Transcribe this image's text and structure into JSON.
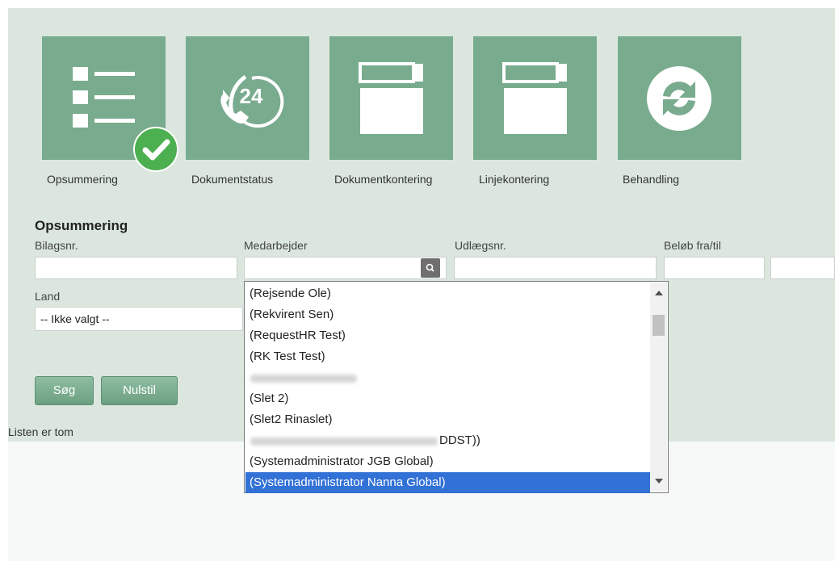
{
  "wizard": {
    "steps": [
      {
        "label": "Opsummering",
        "icon": "list-icon",
        "completed": true
      },
      {
        "label": "Dokumentstatus",
        "icon": "phone-24-icon"
      },
      {
        "label": "Dokumentkontering",
        "icon": "window-icon"
      },
      {
        "label": "Linjekontering",
        "icon": "window-icon"
      },
      {
        "label": "Behandling",
        "icon": "refresh-icon"
      }
    ]
  },
  "form": {
    "title": "Opsummering",
    "fields": {
      "bilagsnr": {
        "label": "Bilagsnr.",
        "value": ""
      },
      "medarbejder": {
        "label": "Medarbejder",
        "value": ""
      },
      "udlaegsnr": {
        "label": "Udlægsnr.",
        "value": ""
      },
      "beloeb": {
        "label": "Beløb fra/til",
        "from": "",
        "to": ""
      },
      "land": {
        "label": "Land",
        "selected": "-- Ikke valgt --"
      }
    },
    "buttons": {
      "search": "Søg",
      "reset": "Nulstil"
    },
    "empty_message": "Listen er tom"
  },
  "dropdown": {
    "options": [
      "(Rejsende Ole)",
      "(Rekvirent Sen)",
      "(RequestHR Test)",
      "(RK Test Test)",
      "",
      "(Slet 2)",
      "(Slet2 Rinaslet)",
      "DDST))",
      "(Systemadministrator JGB Global)",
      "(Systemadministrator Nanna Global)"
    ],
    "selected_index": 9,
    "colors": {
      "highlight": "#3271d6"
    }
  },
  "colors": {
    "accent": "#79ab8e",
    "panel": "#dbe7de",
    "check": "#4caf50"
  }
}
